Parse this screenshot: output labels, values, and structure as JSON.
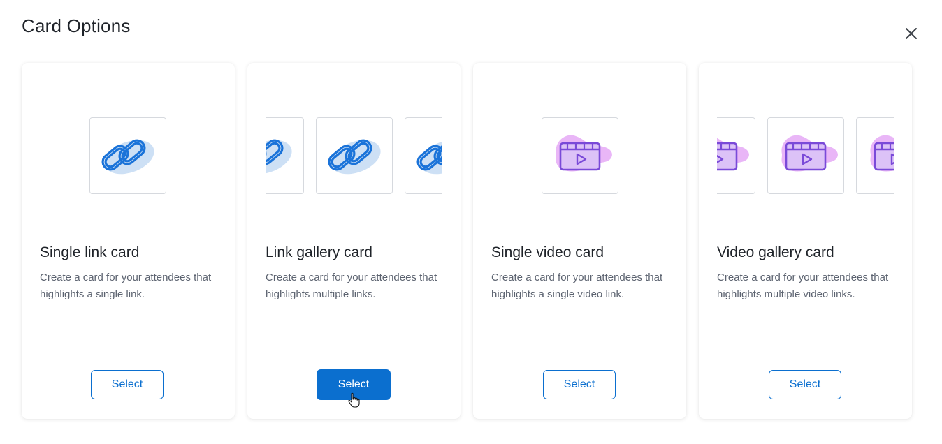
{
  "dialog": {
    "title": "Card Options",
    "close_icon": "close-icon"
  },
  "cards": [
    {
      "title": "Single link card",
      "description": "Create a card for your attendees that highlights a single link.",
      "button_label": "Select",
      "icon": "link-icon"
    },
    {
      "title": "Link gallery card",
      "description": "Create a card for your attendees that highlights multiple links.",
      "button_label": "Select",
      "icon": "link-icon",
      "hovered": true
    },
    {
      "title": "Single video card",
      "description": "Create a card for your attendees that highlights a single video link.",
      "button_label": "Select",
      "icon": "video-icon"
    },
    {
      "title": "Video gallery card",
      "description": "Create a card for your attendees that highlights multiple video links.",
      "button_label": "Select",
      "icon": "video-icon"
    }
  ],
  "colors": {
    "accent": "#0b6fcf",
    "link_icon": "#1a73d9",
    "link_blob": "#cde0f5",
    "video_icon": "#7a4ad8",
    "video_blob": "#e9b6f7"
  }
}
